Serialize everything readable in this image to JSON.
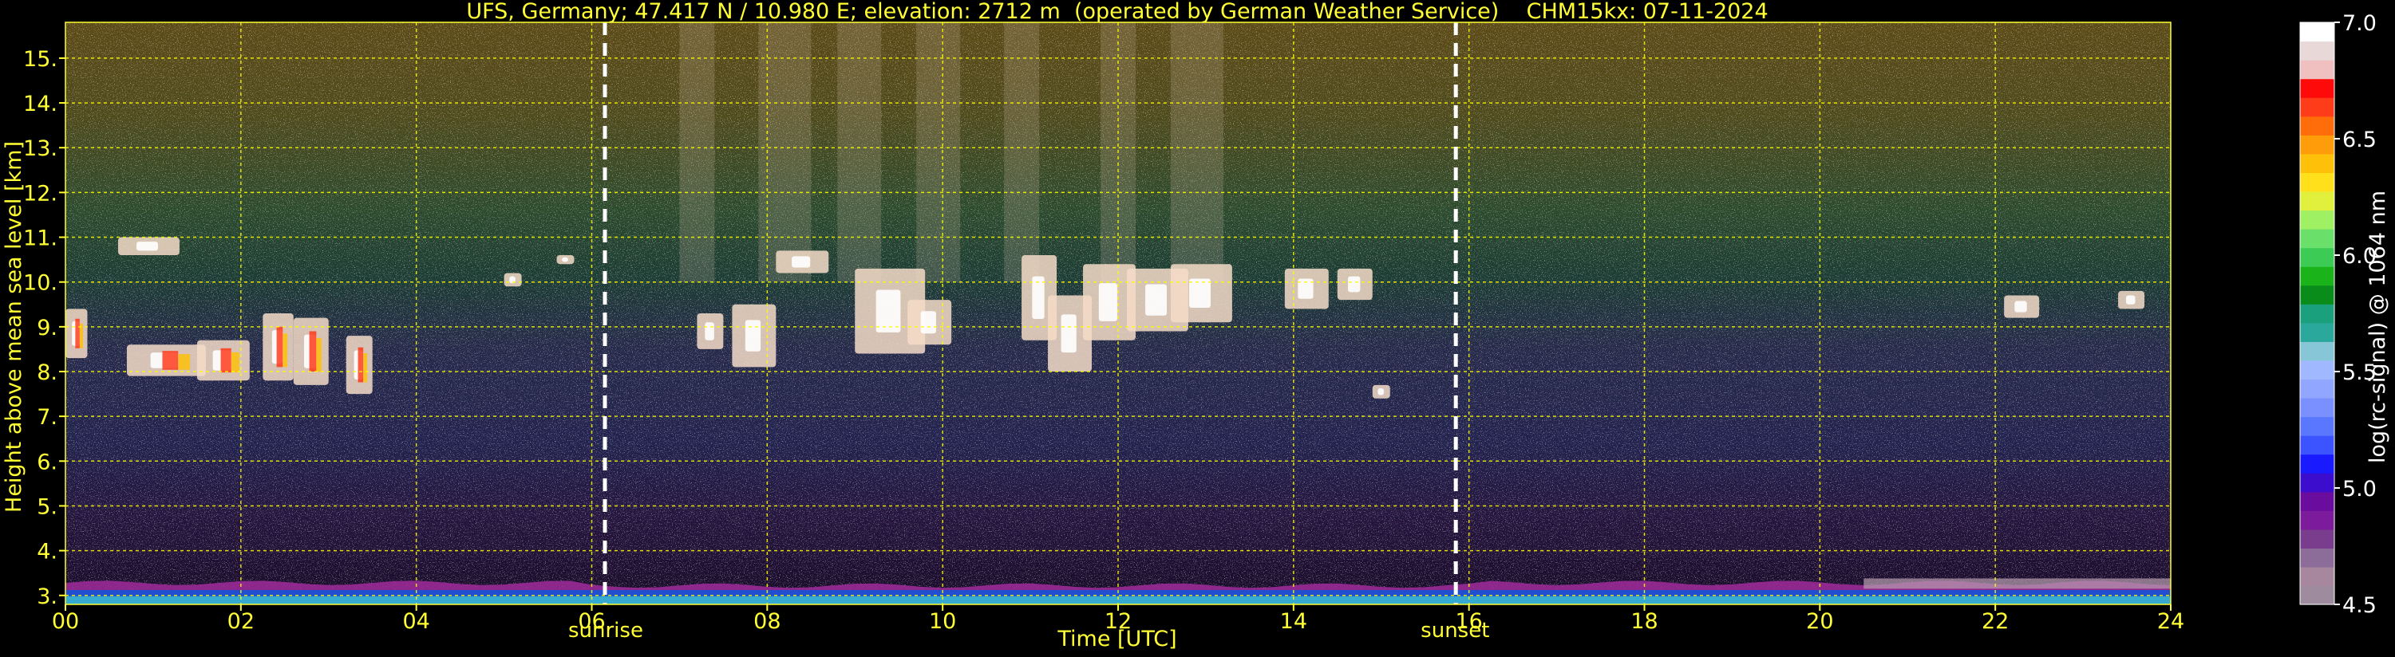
{
  "chart_data": {
    "type": "heatmap",
    "title": "UFS, Germany; 47.417 N / 10.980 E; elevation: 2712 m  (operated by German Weather Service)    CHM15kx: 07-11-2024",
    "xlabel": "Time [UTC]",
    "ylabel": "Height above mean sea level [km]",
    "xlim": [
      0,
      24
    ],
    "ylim": [
      2.8,
      15.8
    ],
    "x_ticks": [
      {
        "value": 0,
        "label": "00"
      },
      {
        "value": 2,
        "label": "02"
      },
      {
        "value": 4,
        "label": "04"
      },
      {
        "value": 6,
        "label": "06"
      },
      {
        "value": 8,
        "label": "08"
      },
      {
        "value": 10,
        "label": "10"
      },
      {
        "value": 12,
        "label": "12"
      },
      {
        "value": 14,
        "label": "14"
      },
      {
        "value": 16,
        "label": "16"
      },
      {
        "value": 18,
        "label": "18"
      },
      {
        "value": 20,
        "label": "20"
      },
      {
        "value": 22,
        "label": "22"
      },
      {
        "value": 24,
        "label": "24"
      }
    ],
    "y_ticks": [
      {
        "value": 3,
        "label": "3."
      },
      {
        "value": 4,
        "label": "4."
      },
      {
        "value": 5,
        "label": "5."
      },
      {
        "value": 6,
        "label": "6."
      },
      {
        "value": 7,
        "label": "7."
      },
      {
        "value": 8,
        "label": "8."
      },
      {
        "value": 9,
        "label": "9."
      },
      {
        "value": 10,
        "label": "10."
      },
      {
        "value": 11,
        "label": "11."
      },
      {
        "value": 12,
        "label": "12."
      },
      {
        "value": 13,
        "label": "13."
      },
      {
        "value": 14,
        "label": "14."
      },
      {
        "value": 15,
        "label": "15."
      }
    ],
    "grid": true,
    "grid_color": "#ffff00",
    "markers": [
      {
        "label": "sunrise",
        "time": 6.15
      },
      {
        "label": "sunset",
        "time": 15.85
      }
    ],
    "colorbar": {
      "label": "log(rc-signal) @ 1064 nm",
      "range": [
        4.5,
        7.0
      ],
      "tick_labels": [
        {
          "value": 7.0,
          "label": "7.0"
        },
        {
          "value": 6.5,
          "label": "6.5"
        },
        {
          "value": 6.0,
          "label": "6.0"
        },
        {
          "value": 5.5,
          "label": "5.5"
        },
        {
          "value": 5.0,
          "label": "5.0"
        },
        {
          "value": 4.5,
          "label": "4.5"
        }
      ],
      "colors": [
        "#9e8c9e",
        "#a6879e",
        "#8c6c99",
        "#7a3c8c",
        "#7c1c9c",
        "#6a0d9e",
        "#3c0dcc",
        "#1a1aff",
        "#3c54ff",
        "#5a78ff",
        "#7a90ff",
        "#90a6ff",
        "#a0b8ff",
        "#86c6d6",
        "#2aa89c",
        "#1aa07c",
        "#0a8c1a",
        "#1ab41a",
        "#3ccc56",
        "#6ae06a",
        "#a0f064",
        "#e0f03c",
        "#ffe01a",
        "#ffc00a",
        "#ff9c0a",
        "#ff6c0a",
        "#ff3c1a",
        "#ff0a0a",
        "#f0c0c0",
        "#e8d8d8",
        "#ffffff"
      ]
    },
    "signal_layers": [
      {
        "height_km": 15.5,
        "hue": "olive/brown noise"
      },
      {
        "height_km": 11.0,
        "hue": "green noise"
      },
      {
        "height_km": 7.0,
        "hue": "blue noise"
      },
      {
        "height_km": 4.5,
        "hue": "violet noise"
      },
      {
        "height_km": 3.1,
        "hue": "blue/magenta ground layer"
      }
    ],
    "clouds": [
      {
        "t0": 0.0,
        "t1": 0.25,
        "z0": 8.3,
        "z1": 9.4
      },
      {
        "t0": 0.6,
        "t1": 1.3,
        "z0": 10.6,
        "z1": 11.0
      },
      {
        "t0": 0.7,
        "t1": 1.6,
        "z0": 7.9,
        "z1": 8.6
      },
      {
        "t0": 1.5,
        "t1": 2.1,
        "z0": 7.8,
        "z1": 8.7
      },
      {
        "t0": 2.25,
        "t1": 2.6,
        "z0": 7.8,
        "z1": 9.3
      },
      {
        "t0": 2.6,
        "t1": 3.0,
        "z0": 7.7,
        "z1": 9.2
      },
      {
        "t0": 3.2,
        "t1": 3.5,
        "z0": 7.5,
        "z1": 8.8
      },
      {
        "t0": 5.0,
        "t1": 5.2,
        "z0": 9.9,
        "z1": 10.2
      },
      {
        "t0": 5.6,
        "t1": 5.8,
        "z0": 10.4,
        "z1": 10.6
      },
      {
        "t0": 7.2,
        "t1": 7.5,
        "z0": 8.5,
        "z1": 9.3
      },
      {
        "t0": 7.6,
        "t1": 8.1,
        "z0": 8.1,
        "z1": 9.5
      },
      {
        "t0": 8.1,
        "t1": 8.7,
        "z0": 10.2,
        "z1": 10.7
      },
      {
        "t0": 9.0,
        "t1": 9.8,
        "z0": 8.4,
        "z1": 10.3
      },
      {
        "t0": 9.6,
        "t1": 10.1,
        "z0": 8.6,
        "z1": 9.6
      },
      {
        "t0": 10.9,
        "t1": 11.3,
        "z0": 8.7,
        "z1": 10.6
      },
      {
        "t0": 11.2,
        "t1": 11.7,
        "z0": 8.0,
        "z1": 9.7
      },
      {
        "t0": 11.6,
        "t1": 12.2,
        "z0": 8.7,
        "z1": 10.4
      },
      {
        "t0": 12.1,
        "t1": 12.8,
        "z0": 8.9,
        "z1": 10.3
      },
      {
        "t0": 12.6,
        "t1": 13.3,
        "z0": 9.1,
        "z1": 10.4
      },
      {
        "t0": 13.9,
        "t1": 14.4,
        "z0": 9.4,
        "z1": 10.3
      },
      {
        "t0": 14.5,
        "t1": 14.9,
        "z0": 9.6,
        "z1": 10.3
      },
      {
        "t0": 14.9,
        "t1": 15.1,
        "z0": 7.4,
        "z1": 7.7
      },
      {
        "t0": 22.1,
        "t1": 22.5,
        "z0": 9.2,
        "z1": 9.7
      },
      {
        "t0": 23.4,
        "t1": 23.7,
        "z0": 9.4,
        "z1": 9.8
      }
    ]
  }
}
